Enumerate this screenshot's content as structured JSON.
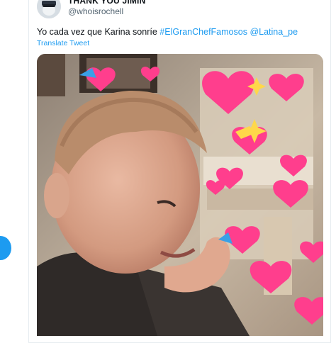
{
  "tweet": {
    "display_name": "THANK YOU JIMIN",
    "handle": "@whoisrochell",
    "text_prefix": "Yo cada vez que Karina sonríe",
    "hashtag": "#ElGranChefFamosos",
    "mention": "@Latina_pe",
    "translate_label": "Translate Tweet",
    "media": {
      "icon": "photo-icon",
      "subject": "child-with-hearts"
    }
  },
  "colors": {
    "link": "#1d9bf0",
    "text": "#0f1419",
    "muted": "#536471",
    "heart_pink": "#ff3e8d"
  }
}
